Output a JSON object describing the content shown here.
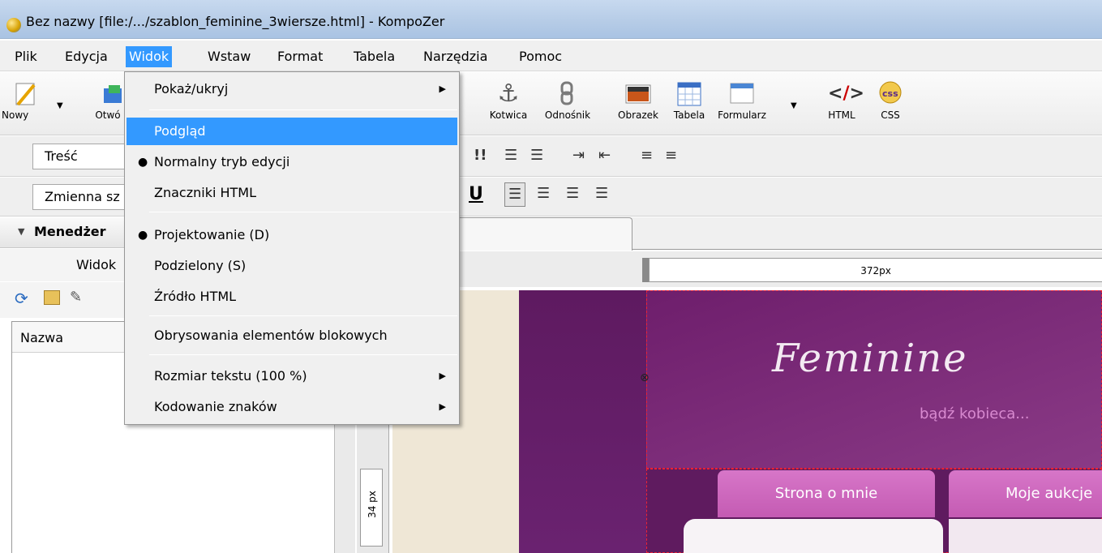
{
  "window": {
    "title": "Bez nazwy [file:/.../szablon_feminine_3wiersze.html] - KompoZer"
  },
  "menubar": [
    "Plik",
    "Edycja",
    "Widok",
    "Wstaw",
    "Format",
    "Tabela",
    "Narzędzia",
    "Pomoc"
  ],
  "toolbar": {
    "nowy": "Nowy",
    "otworz": "Otwó",
    "kotwica": "Kotwica",
    "odnosnik": "Odnośnik",
    "obrazek": "Obrazek",
    "tabela": "Tabela",
    "formularz": "Formularz",
    "html": "HTML",
    "css": "CSS"
  },
  "format_bar": {
    "paragraph_style": "Treść",
    "font": "Zmienna sz"
  },
  "sidebar": {
    "title": "Menedżer",
    "view_label": "Widok",
    "column_header": "Nazwa"
  },
  "ruler": {
    "width_label": "372px",
    "height_label": "34 px"
  },
  "page_content": {
    "logo": "Feminine",
    "slogan": "bądź kobieca...",
    "nav1": "Strona o mnie",
    "nav2": "Moje aukcje"
  },
  "dropdown": {
    "pokaz": "Pokaż/ukryj",
    "podglad": "Podgląd",
    "normalny": "Normalny tryb edycji",
    "znaczniki": "Znaczniki HTML",
    "projektowanie": "Projektowanie (D)",
    "podzielony": "Podzielony (S)",
    "zrodlo": "Źródło HTML",
    "obrysowania": "Obrysowania elementów blokowych",
    "rozmiar": "Rozmiar tekstu (100 %)",
    "kodowanie": "Kodowanie znaków"
  },
  "colors": {
    "accent": "#3399ff",
    "purple": "#6a2270",
    "pink_button": "#d776c8"
  }
}
